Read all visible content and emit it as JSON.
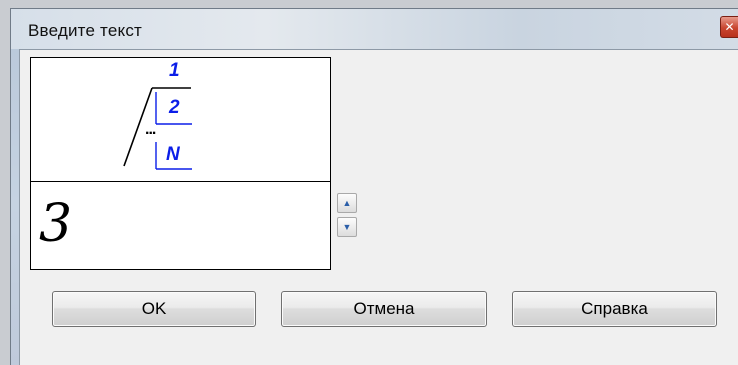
{
  "window": {
    "title": "Введите текст",
    "close_glyph": "✕"
  },
  "preview": {
    "lines": [
      "1",
      "2",
      "N"
    ],
    "ellipsis": "..."
  },
  "input": {
    "value": "3"
  },
  "spinner": {
    "up_glyph": "▲",
    "down_glyph": "▼"
  },
  "buttons": {
    "ok": "OK",
    "cancel": "Отмена",
    "help": "Справка"
  },
  "colors": {
    "symbol_blue": "#0b1ee8"
  }
}
